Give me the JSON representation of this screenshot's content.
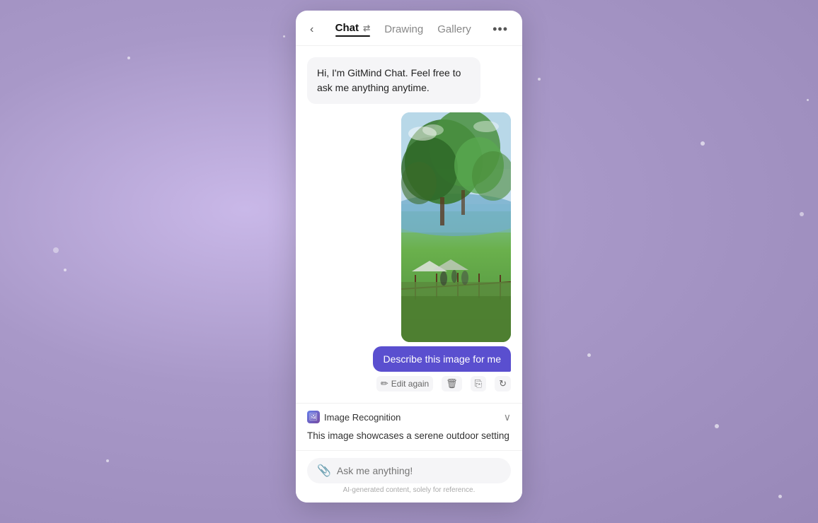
{
  "background": {
    "color": "#b0a0cc"
  },
  "modal": {
    "close_label": "×"
  },
  "header": {
    "back_label": "‹",
    "tabs": [
      {
        "id": "chat",
        "label": "Chat",
        "active": true
      },
      {
        "id": "drawing",
        "label": "Drawing",
        "active": false
      },
      {
        "id": "gallery",
        "label": "Gallery",
        "active": false
      }
    ],
    "swap_icon": "⇄",
    "more_label": "•••",
    "side_arrow_label": "›"
  },
  "messages": [
    {
      "type": "bot",
      "text": "Hi, I'm GitMind Chat. Feel free to ask me anything anytime."
    },
    {
      "type": "image",
      "alt": "Outdoor landscape with trees and sea view"
    },
    {
      "type": "user",
      "text": "Describe this image for me"
    }
  ],
  "actions": [
    {
      "id": "edit",
      "label": "Edit again",
      "icon": "✏️"
    },
    {
      "id": "delete",
      "icon": "🗑"
    },
    {
      "id": "copy",
      "icon": "⎘"
    },
    {
      "id": "refresh",
      "icon": "↻"
    }
  ],
  "recognition": {
    "title": "Image Recognition",
    "icon_label": "🖼",
    "text": "This image showcases a serene outdoor setting",
    "chevron": "∨"
  },
  "input": {
    "placeholder": "Ask me anything!",
    "attach_icon": "📎",
    "disclaimer": "AI-generated content, solely for reference."
  }
}
